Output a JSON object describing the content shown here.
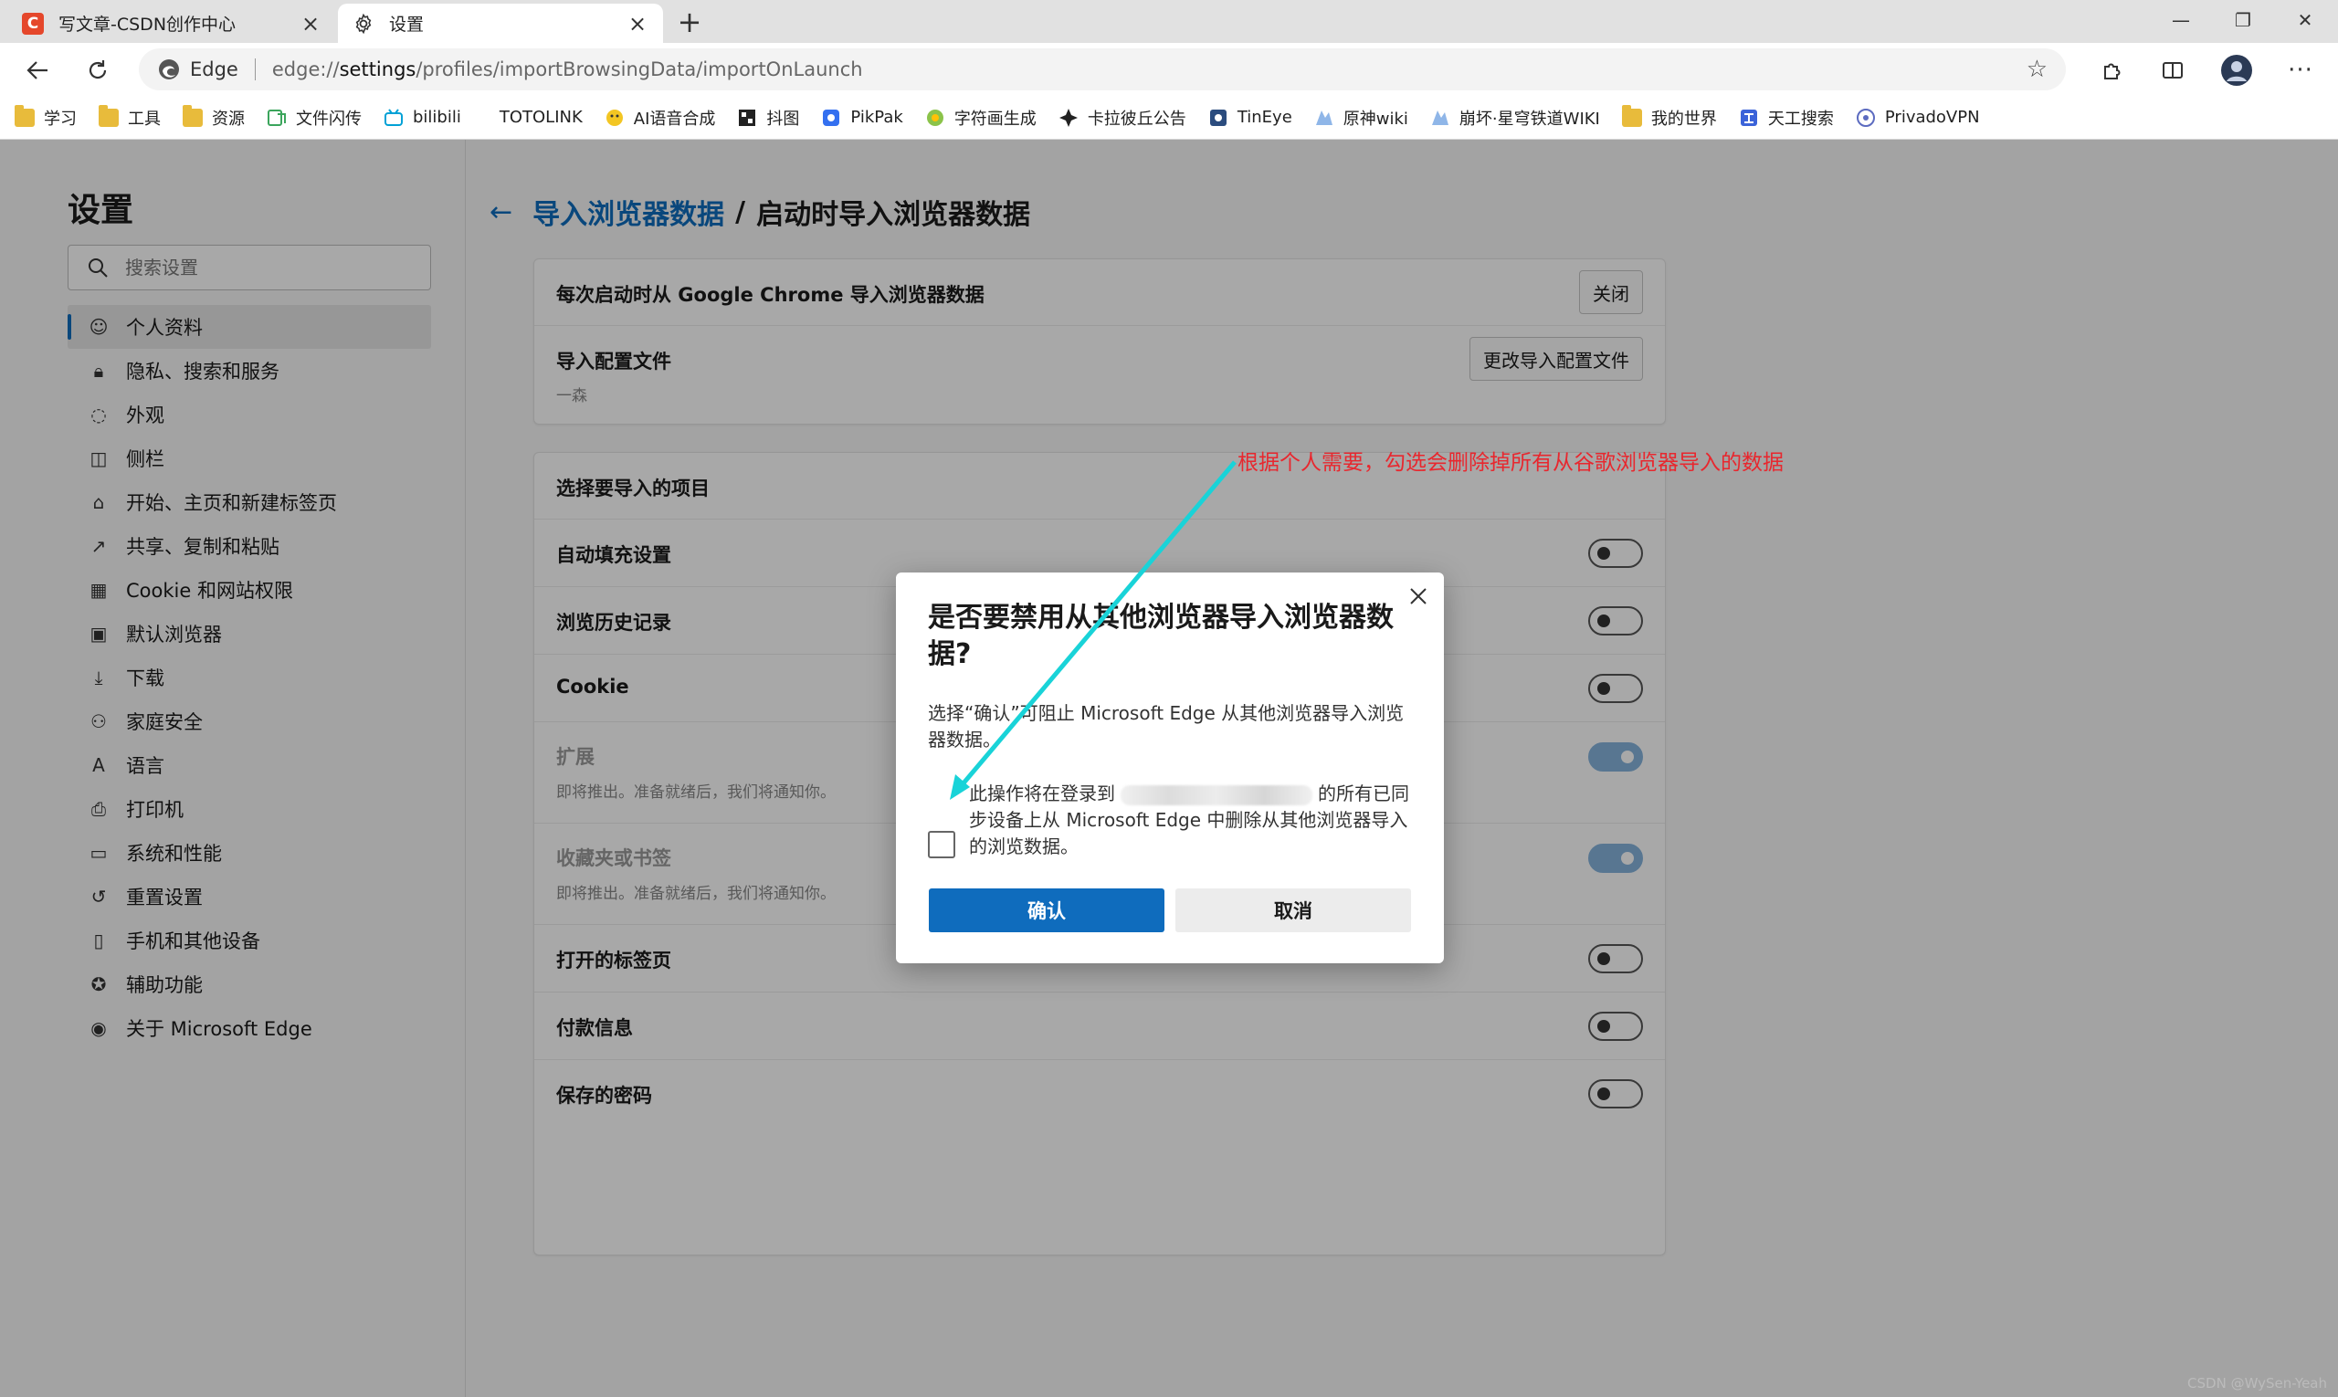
{
  "tabs": [
    {
      "title": "写文章-CSDN创作中心",
      "icon": "csdn-icon",
      "icon_text": "C"
    },
    {
      "title": "设置",
      "icon": "gear-icon"
    }
  ],
  "address": {
    "brand": "Edge",
    "url_prefix": "edge://",
    "url_host": "settings",
    "url_path": "/profiles/importBrowsingData/importOnLaunch"
  },
  "bookmarks": [
    {
      "label": "学习",
      "icon": "folder"
    },
    {
      "label": "工具",
      "icon": "folder"
    },
    {
      "label": "资源",
      "icon": "folder"
    },
    {
      "label": "文件闪传",
      "icon": "filetransfer"
    },
    {
      "label": "bilibili",
      "icon": "bilibili"
    },
    {
      "label": "TOTOLINK",
      "icon": "blank"
    },
    {
      "label": "AI语音合成",
      "icon": "ai"
    },
    {
      "label": "抖图",
      "icon": "doutu"
    },
    {
      "label": "PikPak",
      "icon": "pikpak"
    },
    {
      "label": "字符画生成",
      "icon": "ascii"
    },
    {
      "label": "卡拉彼丘公告",
      "icon": "star"
    },
    {
      "label": "TinEye",
      "icon": "tineye"
    },
    {
      "label": "原神wiki",
      "icon": "wiki"
    },
    {
      "label": "崩坏·星穹铁道WIKI",
      "icon": "wiki"
    },
    {
      "label": "我的世界",
      "icon": "folder"
    },
    {
      "label": "天工搜索",
      "icon": "tiangong"
    },
    {
      "label": "PrivadoVPN",
      "icon": "vpn"
    }
  ],
  "sidebar": {
    "title": "设置",
    "search_placeholder": "搜索设置",
    "items": [
      {
        "label": "个人资料",
        "icon": "profile-icon",
        "active": true
      },
      {
        "label": "隐私、搜索和服务",
        "icon": "lock-icon"
      },
      {
        "label": "外观",
        "icon": "palette-icon"
      },
      {
        "label": "侧栏",
        "icon": "sidebar-icon"
      },
      {
        "label": "开始、主页和新建标签页",
        "icon": "home-icon"
      },
      {
        "label": "共享、复制和粘贴",
        "icon": "share-icon"
      },
      {
        "label": "Cookie 和网站权限",
        "icon": "cookie-icon"
      },
      {
        "label": "默认浏览器",
        "icon": "browser-icon"
      },
      {
        "label": "下载",
        "icon": "download-icon"
      },
      {
        "label": "家庭安全",
        "icon": "family-icon"
      },
      {
        "label": "语言",
        "icon": "language-icon"
      },
      {
        "label": "打印机",
        "icon": "printer-icon"
      },
      {
        "label": "系统和性能",
        "icon": "laptop-icon"
      },
      {
        "label": "重置设置",
        "icon": "reset-icon"
      },
      {
        "label": "手机和其他设备",
        "icon": "phone-icon"
      },
      {
        "label": "辅助功能",
        "icon": "accessibility-icon"
      },
      {
        "label": "关于 Microsoft Edge",
        "icon": "edge-icon"
      }
    ]
  },
  "breadcrumb": {
    "parent": "导入浏览器数据",
    "separator": "/",
    "current": "启动时导入浏览器数据"
  },
  "card1": {
    "row1_label": "每次启动时从 Google Chrome 导入浏览器数据",
    "row1_button": "关闭",
    "row2_label": "导入配置文件",
    "row2_sub": "一森",
    "row2_button": "更改导入配置文件"
  },
  "card2": {
    "header": "选择要导入的项目",
    "items": [
      {
        "label": "自动填充设置",
        "on": false,
        "disabled": false
      },
      {
        "label": "浏览历史记录",
        "on": false,
        "disabled": false
      },
      {
        "label": "Cookie",
        "on": false,
        "disabled": false
      },
      {
        "label": "扩展",
        "sub": "即将推出。准备就绪后，我们将通知你。",
        "on": true,
        "disabled": true
      },
      {
        "label": "收藏夹或书签",
        "sub": "即将推出。准备就绪后，我们将通知你。",
        "on": true,
        "disabled": true
      },
      {
        "label": "打开的标签页",
        "on": false,
        "disabled": false
      },
      {
        "label": "付款信息",
        "on": false,
        "disabled": false
      },
      {
        "label": "保存的密码",
        "on": false,
        "disabled": false
      }
    ]
  },
  "dialog": {
    "title": "是否要禁用从其他浏览器导入浏览器数据?",
    "body": "选择“确认”可阻止 Microsoft Edge 从其他浏览器导入浏览器数据。",
    "checkbox_pre": "此操作将在登录到",
    "checkbox_post": "的所有已同步设备上从 Microsoft Edge 中删除从其他浏览器导入的浏览数据。",
    "checked": false,
    "confirm": "确认",
    "cancel": "取消"
  },
  "annotation": {
    "text": "根据个人需要，勾选会删除掉所有从谷歌浏览器导入的数据",
    "color": "#e8272e",
    "arrow_color": "#19d3d8"
  },
  "watermark": "CSDN @WySen-Yeah",
  "colors": {
    "accent": "#0f6cbd",
    "csdn_red": "#e5472b"
  }
}
